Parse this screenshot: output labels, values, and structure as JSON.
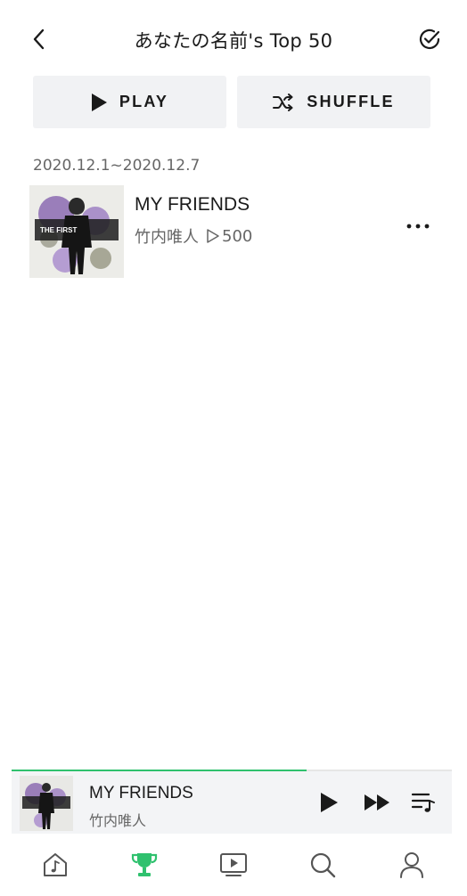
{
  "header": {
    "title": "あなたの名前's Top 50",
    "back_icon": "chevron-left-icon",
    "select_icon": "check-circle-icon"
  },
  "actions": {
    "play_label": "PLAY",
    "shuffle_label": "SHUFFLE"
  },
  "period": "2020.12.1~2020.12.7",
  "tracks": [
    {
      "title": "MY FRIENDS",
      "artist": "竹内唯人",
      "play_count": "500",
      "cover_text": "THE FIRST"
    }
  ],
  "mini_player": {
    "title": "MY FRIENDS",
    "artist": "竹内唯人",
    "progress": 0.67
  },
  "tabs": [
    {
      "name": "home",
      "icon": "home-music-icon",
      "active": false
    },
    {
      "name": "charts",
      "icon": "trophy-icon",
      "active": true
    },
    {
      "name": "video",
      "icon": "video-icon",
      "active": false
    },
    {
      "name": "search",
      "icon": "search-icon",
      "active": false
    },
    {
      "name": "mypage",
      "icon": "profile-icon",
      "active": false
    }
  ],
  "colors": {
    "accent": "#2fc16e",
    "button_bg": "#f1f2f4",
    "text_primary": "#1a1a1a",
    "text_secondary": "#666666"
  }
}
